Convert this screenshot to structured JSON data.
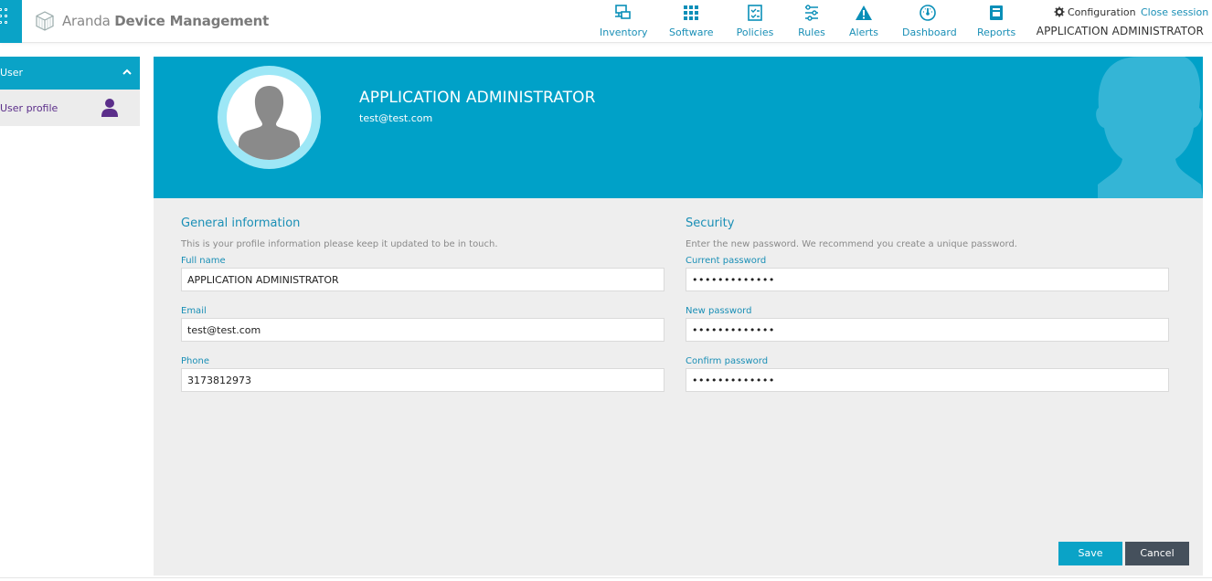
{
  "header": {
    "brand_light": "Aranda",
    "brand_bold": "Device Management",
    "nav": [
      {
        "label": "Inventory",
        "icon": "inventory-icon"
      },
      {
        "label": "Software",
        "icon": "software-icon"
      },
      {
        "label": "Policies",
        "icon": "policies-icon"
      },
      {
        "label": "Rules",
        "icon": "rules-icon"
      },
      {
        "label": "Alerts",
        "icon": "alerts-icon"
      },
      {
        "label": "Dashboard",
        "icon": "dashboard-icon"
      },
      {
        "label": "Reports",
        "icon": "reports-icon"
      }
    ],
    "configuration": "Configuration",
    "close_session": "Close session",
    "user": "APPLICATION ADMINISTRATOR"
  },
  "sidebar": {
    "section": "User",
    "items": [
      {
        "label": "User profile",
        "icon": "user-icon"
      }
    ]
  },
  "profile": {
    "name": "APPLICATION ADMINISTRATOR",
    "email": "test@test.com"
  },
  "general": {
    "title": "General information",
    "description": "This is your profile information please keep it updated to be in touch.",
    "full_name_label": "Full name",
    "full_name": "APPLICATION ADMINISTRATOR",
    "email_label": "Email",
    "email": "test@test.com",
    "phone_label": "Phone",
    "phone": "3173812973"
  },
  "security": {
    "title": "Security",
    "description": "Enter the new password. We recommend you create a unique password.",
    "current_label": "Current password",
    "current_value": "•••••••••••••",
    "new_label": "New password",
    "new_value": "•••••••••••••",
    "confirm_label": "Confirm password",
    "confirm_value": "•••••••••••••"
  },
  "actions": {
    "save": "Save",
    "cancel": "Cancel"
  },
  "colors": {
    "accent": "#0aa3c7",
    "banner": "#00a1c8",
    "link": "#1a8fb6",
    "sidebar_active_text": "#5b2e8a",
    "cancel": "#45505c"
  }
}
